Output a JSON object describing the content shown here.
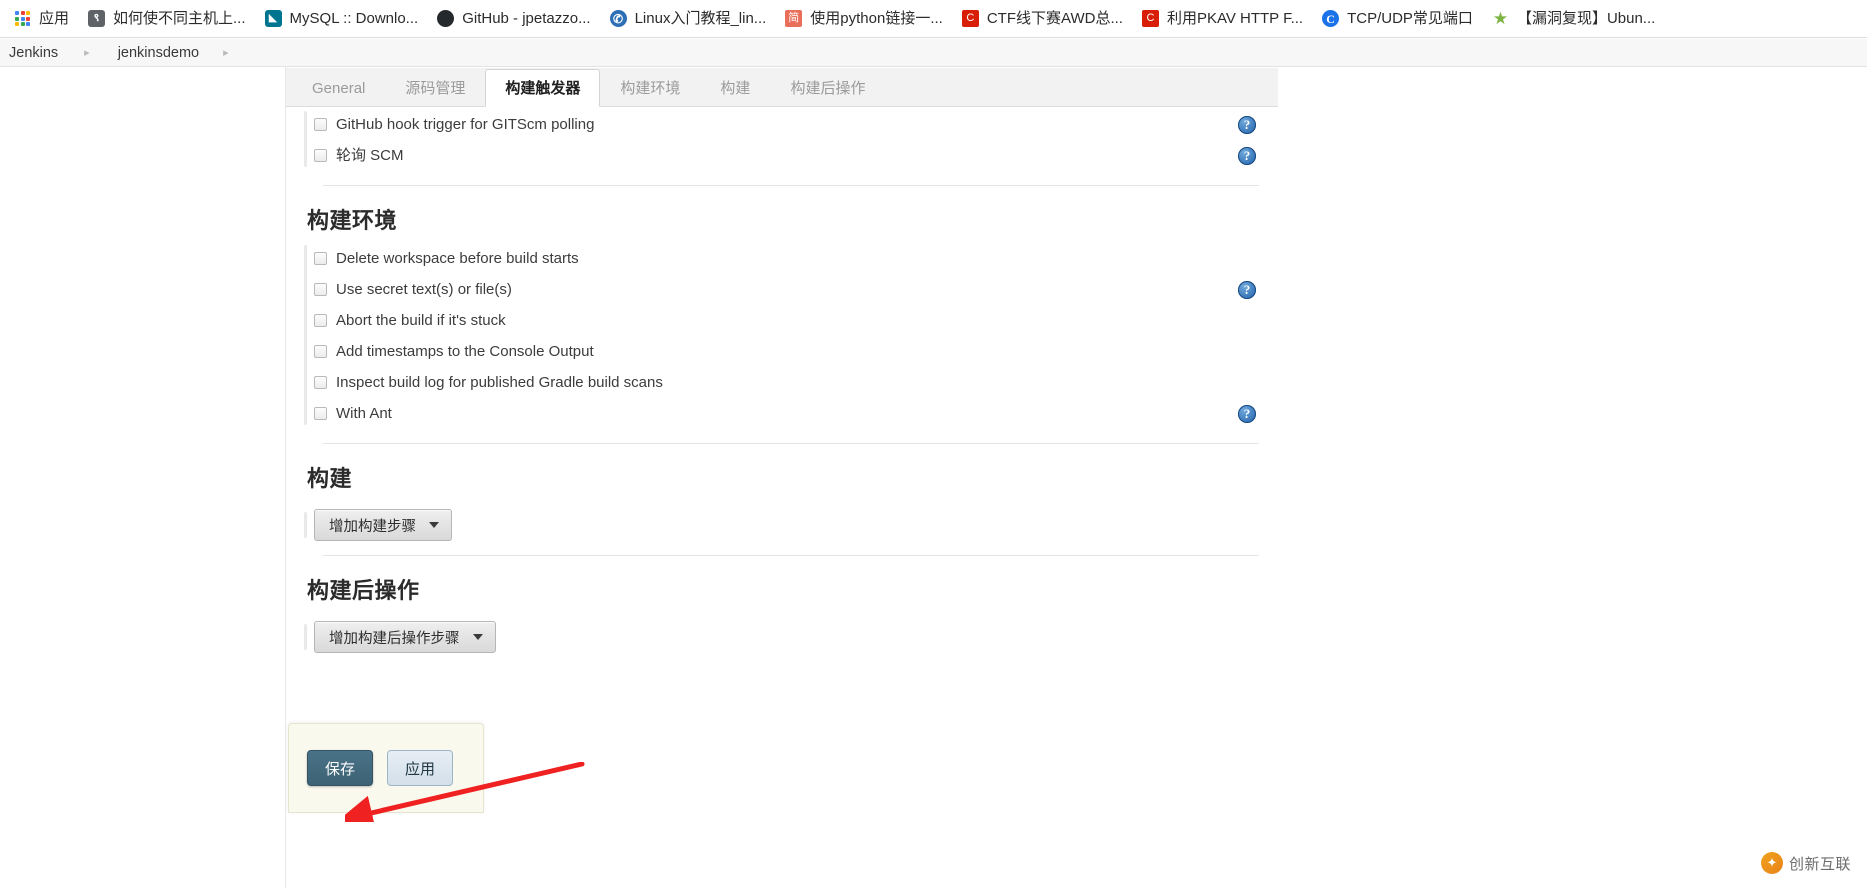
{
  "browser": {
    "bookmarks": [
      {
        "label": "应用",
        "icon": "apps-grid-icon",
        "icon_type": "apps",
        "color": "#4285f4",
        "glyph": ""
      },
      {
        "label": "如何使不同主机上...",
        "icon": "question-mark-icon",
        "icon_type": "glyph",
        "color": "#5f6368",
        "glyph": "९"
      },
      {
        "label": "MySQL :: Downlo...",
        "icon": "mysql-icon",
        "icon_type": "glyph",
        "color": "#00758f",
        "glyph": "◣"
      },
      {
        "label": "GitHub - jpetazzo...",
        "icon": "github-icon",
        "icon_type": "circle",
        "color": "#24292e",
        "glyph": ""
      },
      {
        "label": "Linux入门教程_lin...",
        "icon": "globe-icon",
        "icon_type": "circle",
        "color": "#2c6fb5",
        "glyph": "✆"
      },
      {
        "label": "使用python链接一...",
        "icon": "jianshu-icon",
        "icon_type": "square",
        "color": "#ea6f5a",
        "glyph": "简"
      },
      {
        "label": "CTF线下赛AWD总...",
        "icon": "csdn-icon",
        "icon_type": "square",
        "color": "#d81e06",
        "glyph": "C"
      },
      {
        "label": "利用PKAV HTTP F...",
        "icon": "csdn-icon",
        "icon_type": "square",
        "color": "#d81e06",
        "glyph": "C"
      },
      {
        "label": "TCP/UDP常见端口",
        "icon": "chrome-circle-icon",
        "icon_type": "circle",
        "color": "#1a73e8",
        "glyph": "C"
      },
      {
        "label": "【漏洞复现】Ubun...",
        "icon": "star-icon",
        "icon_type": "star",
        "color": "#7cb342",
        "glyph": "★"
      }
    ]
  },
  "breadcrumb": {
    "items": [
      {
        "label": "Jenkins"
      },
      {
        "label": "jenkinsdemo"
      }
    ],
    "separator": "▸"
  },
  "tabs": [
    {
      "label": "General",
      "active": false
    },
    {
      "label": "源码管理",
      "active": false
    },
    {
      "label": "构建触发器",
      "active": true
    },
    {
      "label": "构建环境",
      "active": false
    },
    {
      "label": "构建",
      "active": false
    },
    {
      "label": "构建后操作",
      "active": false
    }
  ],
  "sections": [
    {
      "name": "build-triggers-section",
      "title": null,
      "checkboxes": [
        {
          "label": "GitHub hook trigger for GITScm polling",
          "checked": false,
          "help": true
        },
        {
          "label": "轮询 SCM",
          "checked": false,
          "help": true
        }
      ]
    },
    {
      "name": "build-environment-section",
      "title": "构建环境",
      "checkboxes": [
        {
          "label": "Delete workspace before build starts",
          "checked": false,
          "help": false
        },
        {
          "label": "Use secret text(s) or file(s)",
          "checked": false,
          "help": true
        },
        {
          "label": "Abort the build if it's stuck",
          "checked": false,
          "help": false
        },
        {
          "label": "Add timestamps to the Console Output",
          "checked": false,
          "help": false
        },
        {
          "label": "Inspect build log for published Gradle build scans",
          "checked": false,
          "help": false
        },
        {
          "label": "With Ant",
          "checked": false,
          "help": true
        }
      ]
    },
    {
      "name": "build-section",
      "title": "构建",
      "checkboxes": [],
      "dropdown_button": "增加构建步骤"
    },
    {
      "name": "post-build-section",
      "title": "构建后操作",
      "checkboxes": [],
      "dropdown_button": "增加构建后操作步骤"
    }
  ],
  "actions": {
    "save_label": "保存",
    "apply_label": "应用",
    "save_color": "#3c6274",
    "apply_color": "#d3dfe9"
  },
  "annotation": {
    "type": "arrow",
    "color": "#ef2121",
    "points_to": "save-button"
  },
  "watermark": {
    "text": "创新互联",
    "logo_glyph": "✦",
    "color": "#6d6d6d"
  },
  "help_icon_glyph": "?"
}
